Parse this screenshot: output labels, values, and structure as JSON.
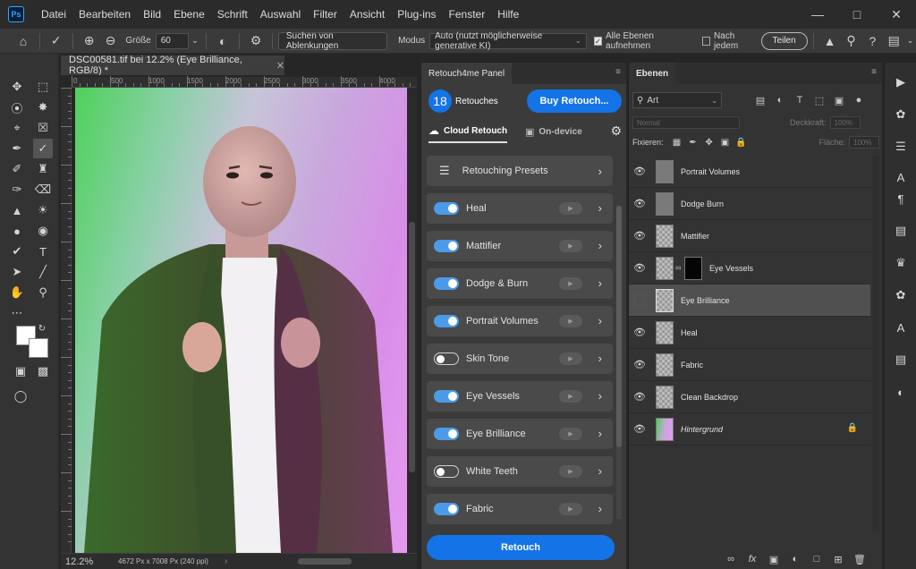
{
  "app": {
    "logo_text": "Ps",
    "menus": [
      "Datei",
      "Bearbeiten",
      "Bild",
      "Ebene",
      "Schrift",
      "Auswahl",
      "Filter",
      "Ansicht",
      "Plug-ins",
      "Fenster",
      "Hilfe"
    ]
  },
  "options": {
    "size_label": "Größe",
    "size_value": "60",
    "find_distractions": "Suchen von Ablenkungen",
    "mode_label": "Modus",
    "mode_value": "Auto (nutzt möglicherweise generative KI)",
    "all_layers_label": "Alle Ebenen aufnehmen",
    "after_each_label": "Nach jedem",
    "share_label": "Teilen"
  },
  "document": {
    "tab_title": "DSC00581.tif bei 12.2% (Eye Brilliance, RGB/8) *",
    "ruler_labels": [
      "0",
      "500",
      "1000",
      "1500",
      "2000",
      "2500",
      "3000",
      "3500",
      "4000"
    ],
    "zoom": "12.2%",
    "dimensions": "4672 Px x 7008 Px (240 ppi)"
  },
  "retouch_panel": {
    "title": "Retouch4me Panel",
    "count": "18",
    "count_label": "Retouches",
    "buy_label": "Buy Retouch...",
    "mode_cloud": "Cloud Retouch",
    "mode_device": "On-device",
    "presets_label": "Retouching Presets",
    "items": [
      {
        "name": "Heal",
        "on": true
      },
      {
        "name": "Mattifier",
        "on": true
      },
      {
        "name": "Dodge & Burn",
        "on": true
      },
      {
        "name": "Portrait Volumes",
        "on": true
      },
      {
        "name": "Skin Tone",
        "on": false
      },
      {
        "name": "Eye Vessels",
        "on": true
      },
      {
        "name": "Eye Brilliance",
        "on": true
      },
      {
        "name": "White Teeth",
        "on": false
      },
      {
        "name": "Fabric",
        "on": true
      }
    ],
    "retouch_label": "Retouch"
  },
  "layers_panel": {
    "title": "Ebenen",
    "filter_value": "Art",
    "blend_mode": "Normal",
    "opacity_label": "Deckkraft:",
    "opacity_value": "100%",
    "lock_label": "Fixieren:",
    "fill_label": "Fläche:",
    "fill_value": "100%",
    "layers": [
      {
        "name": "Portrait Volumes",
        "thumb": "solid",
        "visible": true,
        "selected": false
      },
      {
        "name": "Dodge Burn",
        "thumb": "solid",
        "visible": true,
        "selected": false
      },
      {
        "name": "Mattifier",
        "thumb": "transparent",
        "visible": true,
        "selected": false
      },
      {
        "name": "Eye Vessels",
        "thumb": "transparent-mask",
        "visible": true,
        "selected": false
      },
      {
        "name": "Eye Brilliance",
        "thumb": "transparent",
        "visible": false,
        "selected": true
      },
      {
        "name": "Heal",
        "thumb": "transparent",
        "visible": true,
        "selected": false
      },
      {
        "name": "Fabric",
        "thumb": "transparent",
        "visible": true,
        "selected": false
      },
      {
        "name": "Clean Backdrop",
        "thumb": "transparent",
        "visible": true,
        "selected": false
      },
      {
        "name": "Hintergrund",
        "thumb": "photo",
        "visible": true,
        "selected": false,
        "locked": true
      }
    ]
  },
  "colors": {
    "accent_blue": "#1473e6",
    "toggle_on": "#4b9be8",
    "panel_bg": "#3b3b3b"
  }
}
